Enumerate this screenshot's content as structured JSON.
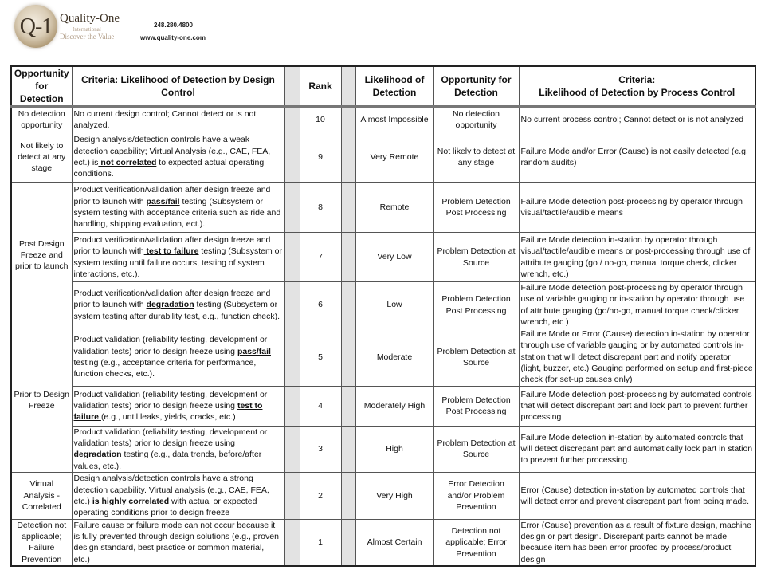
{
  "header": {
    "logo_mark": "Q-1",
    "brand_name": "Quality-One",
    "brand_sub1": "International",
    "brand_sub2": "Discover the Value",
    "phone": "248.280.4800",
    "website": "www.quality-one.com"
  },
  "table": {
    "columns": {
      "opportunity_design": "Opportunity for Detection",
      "criteria_design": "Criteria: Likelihood of Detection by Design Control",
      "rank": "Rank",
      "likelihood": "Likelihood of Detection",
      "opportunity_process": "Opportunity for Detection",
      "criteria_process_line1": "Criteria:",
      "criteria_process_line2": "Likelihood of Detection by Process Control"
    },
    "groups": {
      "g10": "No detection opportunity",
      "g9": "Not likely to detect at any stage",
      "post_design": "Post Design Freeze and prior to launch",
      "prior_design": "Prior to Design Freeze",
      "g2": "Virtual Analysis - Correlated",
      "g1": "Detection not applicable; Failure Prevention"
    },
    "rows": [
      {
        "rank": "10",
        "design_pre": "No current design control; Cannot detect or is not analyzed.",
        "design_kw": "",
        "design_post": "",
        "likelihood": "Almost Impossible",
        "opportunity_process": "No detection opportunity",
        "criteria_process": "No current process control; Cannot detect or is not analyzed"
      },
      {
        "rank": "9",
        "design_pre": "Design analysis/detection controls have a weak detection capability; Virtual Analysis (e.g., CAE, FEA, ect.) is",
        "design_kw": " not correlated",
        "design_post": " to expected actual operating conditions.",
        "likelihood": "Very Remote",
        "opportunity_process": "Not likely to detect at any stage",
        "criteria_process": "Failure Mode and/or Error (Cause) is not easily detected (e.g. random audits)"
      },
      {
        "rank": "8",
        "design_pre": "Product verification/validation after design freeze and prior to launch with ",
        "design_kw": "pass/fail",
        "design_post": " testing (Subsystem or system testing with acceptance criteria such as ride and handling, shipping evaluation, ect.).",
        "likelihood": "Remote",
        "opportunity_process": "Problem Detection Post Processing",
        "criteria_process": "Failure Mode detection post-processing by operator through visual/tactile/audible means"
      },
      {
        "rank": "7",
        "design_pre": "Product verification/validation after design freeze and prior to launch with",
        "design_kw": " test to failure",
        "design_post": " testing (Subsystem or system testing until failure occurs, testing of system interactions, etc.).",
        "likelihood": "Very Low",
        "opportunity_process": "Problem Detection at Source",
        "criteria_process": "Failure Mode detection in-station by operator through visual/tactile/audible means or post-processing through use of attribute gauging (go / no-go, manual torque check, clicker wrench, etc.)"
      },
      {
        "rank": "6",
        "design_pre": "Product verification/validation after design freeze and prior to launch with ",
        "design_kw": "degradation",
        "design_post": " testing (Subsystem or system testing after durability test, e.g., function check).",
        "likelihood": "Low",
        "opportunity_process": "Problem Detection Post Processing",
        "criteria_process": "Failure Mode detection post-processing by operator through use of variable gauging or in-station by operator through use of attribute gauging (go/no-go, manual torque check/clicker wrench, etc )"
      },
      {
        "rank": "5",
        "design_pre": "Product validation (reliability testing, development or validation tests) prior to design freeze using ",
        "design_kw": "pass/fail ",
        "design_post": "testing (e.g., acceptance criteria for performance, function checks, etc.).",
        "likelihood": "Moderate",
        "opportunity_process": "Problem Detection at Source",
        "criteria_process": "Failure Mode or Error (Cause) detection in-station by operator through use of variable gauging or by automated controls in-station that will detect discrepant part and notify operator (light, buzzer, etc.)  Gauging performed on setup and first-piece check (for set-up causes only)"
      },
      {
        "rank": "4",
        "design_pre": "Product validation (reliability testing, development or validation tests) prior to design freeze using ",
        "design_kw": "test to failure ",
        "design_post": "(e.g., until leaks, yields, cracks, etc.)",
        "likelihood": "Moderately High",
        "opportunity_process": "Problem Detection Post Processing",
        "criteria_process": "Failure Mode detection post-processing by automated controls that will detect discrepant part and lock part to prevent further processing"
      },
      {
        "rank": "3",
        "design_pre": "Product validation (reliability testing, development or validation tests) prior to design freeze using ",
        "design_kw": "degradation ",
        "design_post": "testing (e.g., data trends, before/after values, etc.).",
        "likelihood": "High",
        "opportunity_process": "Problem Detection at Source",
        "criteria_process": "Failure Mode detection in-station by automated controls that will detect discrepant part and automatically lock part in station to prevent further processing."
      },
      {
        "rank": "2",
        "design_pre": "Design analysis/detection controls have a strong detection capability. Virtual analysis (e.g., CAE, FEA, etc.) ",
        "design_kw": "is highly correlated",
        "design_post": " with actual or expected operating conditions prior to design freeze",
        "likelihood": "Very High",
        "opportunity_process": "Error Detection and/or Problem Prevention",
        "criteria_process": "Error (Cause) detection in-station by automated controls that will detect error and prevent discrepant part from being made."
      },
      {
        "rank": "1",
        "design_pre": "Failure cause or failure mode can not occur because it is fully prevented through design solutions (e.g., proven design standard, best practice or common material, etc.)",
        "design_kw": "",
        "design_post": "",
        "likelihood": "Almost Certain",
        "opportunity_process": "Detection not applicable; Error Prevention",
        "criteria_process": "Error (Cause) prevention as a result of fixture design, machine design or part design.  Discrepant parts cannot be made because item has been error proofed by process/product design"
      }
    ]
  }
}
